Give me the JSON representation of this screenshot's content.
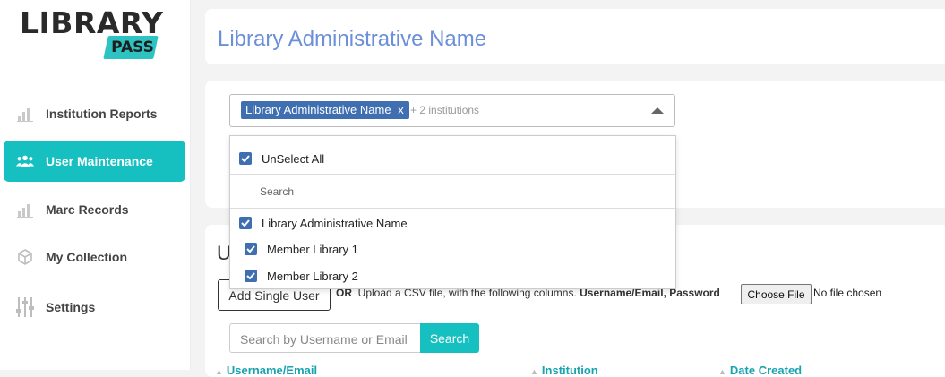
{
  "brand": {
    "word": "LIBRARY",
    "badge": "PASS"
  },
  "sidebar": {
    "items": [
      {
        "label": "Institution Reports",
        "icon": "bar-chart-icon"
      },
      {
        "label": "User Maintenance",
        "icon": "users-icon"
      },
      {
        "label": "Marc Records",
        "icon": "bar-chart-icon"
      },
      {
        "label": "My Collection",
        "icon": "cube-icon"
      },
      {
        "label": "Settings",
        "icon": "sliders-icon"
      }
    ]
  },
  "header": {
    "title": "Library Administrative Name"
  },
  "selector": {
    "chip_label": "Library Administrative Name",
    "chip_remove": "x",
    "more_label": "+ 2 institutions"
  },
  "dropdown": {
    "unselect_all": "UnSelect All",
    "search_placeholder": "Search",
    "options": [
      {
        "label": "Library Administrative Name",
        "checked": true
      },
      {
        "label": "Member Library 1",
        "checked": true
      },
      {
        "label": "Member Library 2",
        "checked": true
      }
    ]
  },
  "users_section": {
    "title_partial": "U",
    "add_single_user": "Add Single User",
    "or_label": "OR",
    "upload_text": "Upload a CSV file, with the following columns.",
    "upload_columns": "Username/Email, Password",
    "choose_file": "Choose File",
    "no_file": "No file chosen",
    "search_placeholder": "Search by Username or Email",
    "search_button": "Search",
    "columns": [
      "Username/Email",
      "Institution",
      "Date Created"
    ]
  },
  "colors": {
    "accent": "#17c0c0",
    "title": "#6b8fd8",
    "chip": "#3f6fb0"
  }
}
